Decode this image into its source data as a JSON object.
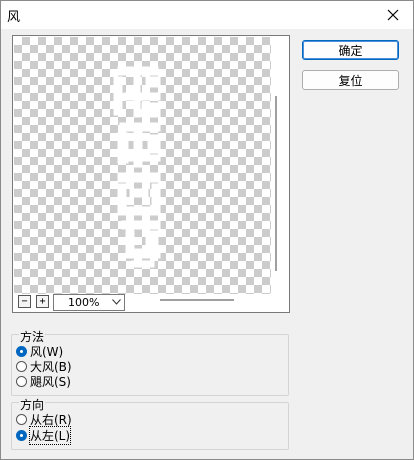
{
  "window": {
    "title": "风",
    "close_icon": "close-icon"
  },
  "preview": {
    "zoom_out_label": "−",
    "zoom_in_label": "+",
    "zoom_value": "100%"
  },
  "buttons": {
    "ok_label": "确定",
    "reset_label": "复位"
  },
  "method_group": {
    "label": "方法",
    "options": [
      {
        "label": "风(W)",
        "checked": true
      },
      {
        "label": "大风(B)",
        "checked": false
      },
      {
        "label": "飓风(S)",
        "checked": false
      }
    ]
  },
  "direction_group": {
    "label": "方向",
    "options": [
      {
        "label": "从右(R)",
        "checked": false
      },
      {
        "label": "从左(L)",
        "checked": true
      }
    ]
  },
  "colors": {
    "accent": "#0067c0"
  }
}
